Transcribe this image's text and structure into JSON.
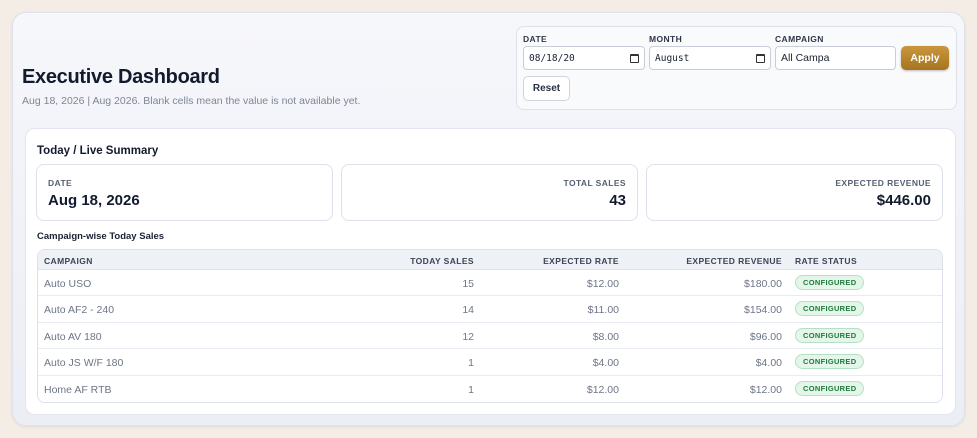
{
  "header": {
    "title": "Executive Dashboard",
    "subtitle": "Aug 18, 2026 | Aug 2026. Blank cells mean the value is not available yet."
  },
  "filters": {
    "date_label": "DATE",
    "date_value": "08/18/20",
    "month_label": "MONTH",
    "month_value": "August",
    "campaign_label": "CAMPAIGN",
    "campaign_value": "All Campa",
    "apply_label": "Apply",
    "reset_label": "Reset"
  },
  "summary": {
    "section_title": "Today / Live Summary",
    "date_label": "DATE",
    "date_value": "Aug 18, 2026",
    "sales_label": "TOTAL SALES",
    "sales_value": "43",
    "revenue_label": "EXPECTED REVENUE",
    "revenue_value": "$446.00"
  },
  "campaign_table": {
    "title": "Campaign-wise Today Sales",
    "headers": [
      "CAMPAIGN",
      "TODAY SALES",
      "EXPECTED RATE",
      "EXPECTED REVENUE",
      "RATE STATUS"
    ],
    "rows": [
      {
        "campaign": "Auto USO",
        "sales": "15",
        "rate": "$12.00",
        "revenue": "$180.00",
        "status": "CONFIGURED"
      },
      {
        "campaign": "Auto AF2 - 240",
        "sales": "14",
        "rate": "$11.00",
        "revenue": "$154.00",
        "status": "CONFIGURED"
      },
      {
        "campaign": "Auto AV 180",
        "sales": "12",
        "rate": "$8.00",
        "revenue": "$96.00",
        "status": "CONFIGURED"
      },
      {
        "campaign": "Auto JS W/F 180",
        "sales": "1",
        "rate": "$4.00",
        "revenue": "$4.00",
        "status": "CONFIGURED"
      },
      {
        "campaign": "Home AF RTB",
        "sales": "1",
        "rate": "$12.00",
        "revenue": "$12.00",
        "status": "CONFIGURED"
      }
    ]
  },
  "colors": {
    "accent": "#b8862e",
    "badge_bg": "#e4f6ea",
    "badge_text": "#1f7a3e"
  }
}
